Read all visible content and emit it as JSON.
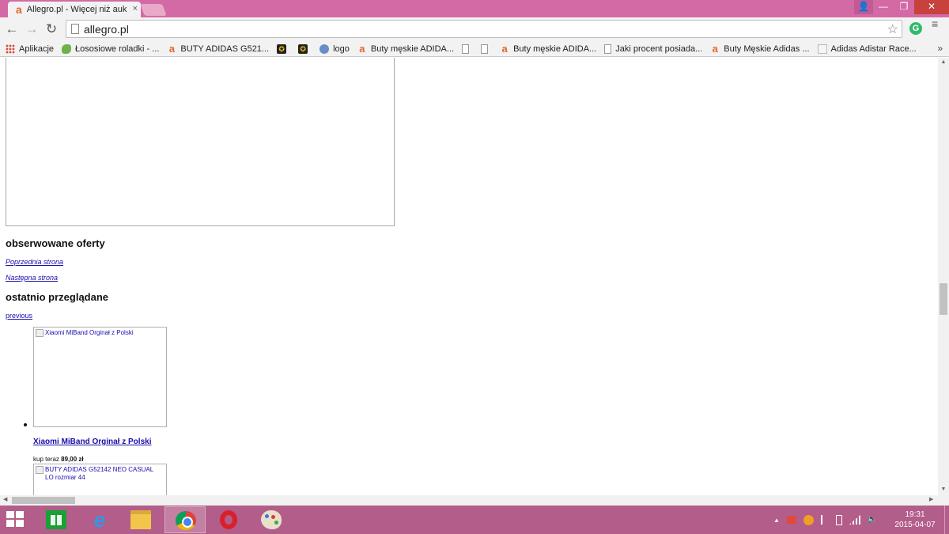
{
  "browser": {
    "tab_title": "Allegro.pl - Więcej niż auk",
    "tab_favicon": "a",
    "tab_close": "×",
    "url": "allegro.pl",
    "back": "←",
    "forward": "→",
    "reload": "↻",
    "star": "☆",
    "extension_badge": "G",
    "menu": "≡",
    "win_user": "👤",
    "win_min": "—",
    "win_max": "❐",
    "win_close": "✕"
  },
  "bookmarks": [
    {
      "label": "Aplikacje",
      "icon": "apps-grid-icon"
    },
    {
      "label": "Łososiowe roladki - ...",
      "icon": "fish-icon"
    },
    {
      "label": "BUTY ADIDAS G521...",
      "icon": "allegro-icon"
    },
    {
      "label": "",
      "icon": "gold-badge-icon"
    },
    {
      "label": "",
      "icon": "gold-badge-icon"
    },
    {
      "label": "logo",
      "icon": "globe-icon"
    },
    {
      "label": "Buty męskie ADIDA...",
      "icon": "allegro-icon"
    },
    {
      "label": "",
      "icon": "page-icon"
    },
    {
      "label": "",
      "icon": "page-icon"
    },
    {
      "label": "Buty męskie ADIDA...",
      "icon": "allegro-icon"
    },
    {
      "label": "Jaki procent posiada...",
      "icon": "page-icon"
    },
    {
      "label": "Buty Męskie Adidas ...",
      "icon": "allegro-icon"
    },
    {
      "label": "Adidas Adistar Race...",
      "icon": "adistar-icon"
    }
  ],
  "bookmarks_more": "»",
  "page": {
    "watched_heading": "obserwowane oferty",
    "prev_page": "Poprzednia strona",
    "next_page": "Następna strona",
    "recent_heading": "ostatnio przeglądane",
    "previous_link": "previous",
    "items": [
      {
        "alt": "Xiaomi MiBand Orginał z Polski",
        "title": "Xiaomi MiBand Orginał z Polski",
        "price_prefix": "kup teraz",
        "price": "89,00 zł"
      },
      {
        "alt": "BUTY ADIDAS G52142 NEO CASUAL LO rozmiar 44"
      }
    ]
  },
  "taskbar": {
    "clock_time": "19:31",
    "clock_date": "2015-04-07",
    "tray_up": "▲",
    "apps": [
      "store-icon",
      "internet-explorer-icon",
      "file-explorer-icon",
      "chrome-icon",
      "opera-icon",
      "paint-icon"
    ]
  }
}
